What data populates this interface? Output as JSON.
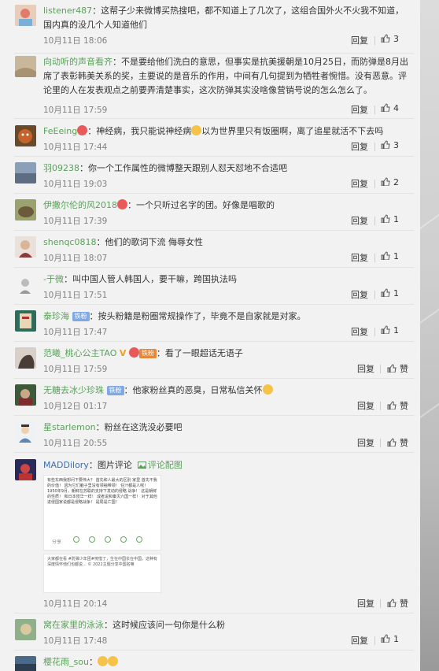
{
  "comments": [
    {
      "user": "listener487",
      "text": "：这帮子少来微博买热搜吧，都不知道上了几次了，这组合国外火不火我不知道，国内真的没几个人知道他们",
      "time": "10月11日 18:06",
      "reply": "回复",
      "likes": "3"
    },
    {
      "user": "向动听的声音看齐",
      "text": "：不是要给他们洗白的意思，但事实是抗美援朝是10月25日，而防弹是8月出席了表彰韩美关系的奖，主要说的是音乐的作用，中间有几句提到为牺牲者惋惜。没有恶意。评论里的人在发表观点之前要弄清楚事实，这次防弹其实没啥像营销号说的怎么怎么了。",
      "time": "10月11日 17:59",
      "reply": "回复",
      "likes": "4"
    },
    {
      "user": "FeEeing",
      "text": "：神经病，我只能说神经病",
      "text2": "以为世界里只有饭圈啊，离了追星就活不下去吗",
      "time": "10月11日 17:44",
      "reply": "回复",
      "likes": "3"
    },
    {
      "user": "羽09238",
      "text": "：你一个工作属性的微博整天跟别人怼天怼地不合适吧",
      "time": "10月11日 19:03",
      "reply": "回复",
      "likes": "2"
    },
    {
      "user": "伊撒尔伦的风2018",
      "text": "：一个只听过名字的团。好像是唱歌的",
      "time": "10月11日 17:39",
      "reply": "回复",
      "likes": "1"
    },
    {
      "user": "shenqc0818",
      "text": "：他们的歌词下流 侮辱女性",
      "time": "10月11日 18:07",
      "reply": "回复",
      "likes": "1"
    },
    {
      "user": "-于微",
      "text": "：叫中国人管人韩国人，要干嘛，跨国执法吗",
      "time": "10月11日 17:51",
      "reply": "回复",
      "likes": "1"
    },
    {
      "user": "泰珍海",
      "badge": "铁粉",
      "text": "：按头粉籍是粉圈常规操作了，毕竟不是自家就是对家。",
      "time": "10月11日 17:47",
      "reply": "回复",
      "likes": "1"
    },
    {
      "user": "范曦_桃心公主TAO",
      "vmark": "V",
      "badge": "铁粉",
      "text": "：看了一眼超话无语子",
      "time": "10月11日 17:59",
      "reply": "回复",
      "likes": "赞"
    },
    {
      "user": "无糖去冰少珍珠",
      "badge": "铁粉",
      "text": "：他家粉丝真的恶臭，日常私信关怀",
      "time": "10月12日 01:17",
      "reply": "回复",
      "likes": "赞"
    },
    {
      "user": "星starlemon",
      "text": "：粉丝在这洗没必要吧",
      "time": "10月11日 20:55",
      "reply": "回复",
      "likes": "赞"
    },
    {
      "user": "MADDilory",
      "text": "：图片评论",
      "piclink": "评论配图",
      "time": "10月11日 20:14",
      "reply": "回复",
      "likes": "赞",
      "pic1": "有些东西我想问下要伟大？ 首先和人最大的区别 家里 首先不我的价值！ 因为它们脑子里没有领袖带领！ 任汁都是人呢！ 1950年9月，朝鲜在苏联的支持下发动的侵略 战争！ 这是朝鲜的性质！ 和日本侵华一样！ 成者说和秦灭六国一样！ 对于其他进侵国家说都是侵略战争！ 是局是亡国！",
      "pic1bar": "分享",
      "pic2": "大家都在看 #防弹少年团#惋惜了，生在中国长在中国，这种有深度情怀他们也都说... © 2022主题分享中国名嘛"
    },
    {
      "user": "窝在家里的泳泳",
      "text": "：这时候应该问一句你是什么粉",
      "time": "10月11日 17:48",
      "reply": "回复",
      "likes": "1"
    },
    {
      "user": "樱花雨_sou",
      "text": "："
    }
  ]
}
